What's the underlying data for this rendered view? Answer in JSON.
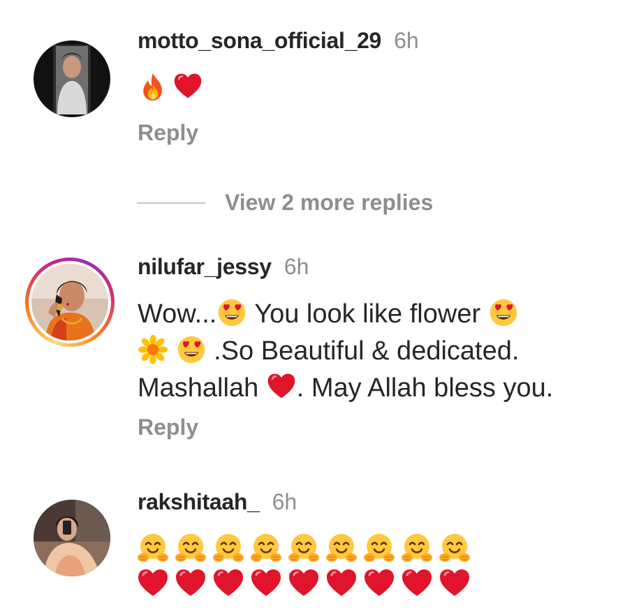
{
  "comments": [
    {
      "username": "motto_sona_official_29",
      "time": "6h",
      "emojis": [
        "fire-emoji",
        "red-heart-emoji"
      ],
      "reply_label": "Reply"
    },
    {
      "username": "nilufar_jessy",
      "time": "6h",
      "text_parts": [
        "Wow...",
        " You look like flower ",
        ".So Beautiful & dedicated.",
        "Mashallah ",
        ". May Allah bless you."
      ],
      "reply_label": "Reply"
    },
    {
      "username": "rakshitaah_",
      "time": "6h",
      "hug_count": 9,
      "heart_count": 9
    }
  ],
  "view_more_label": "View 2 more replies",
  "colors": {
    "primary_text": "#262626",
    "secondary_text": "#8e8e8e",
    "heart": "#e0142b"
  }
}
